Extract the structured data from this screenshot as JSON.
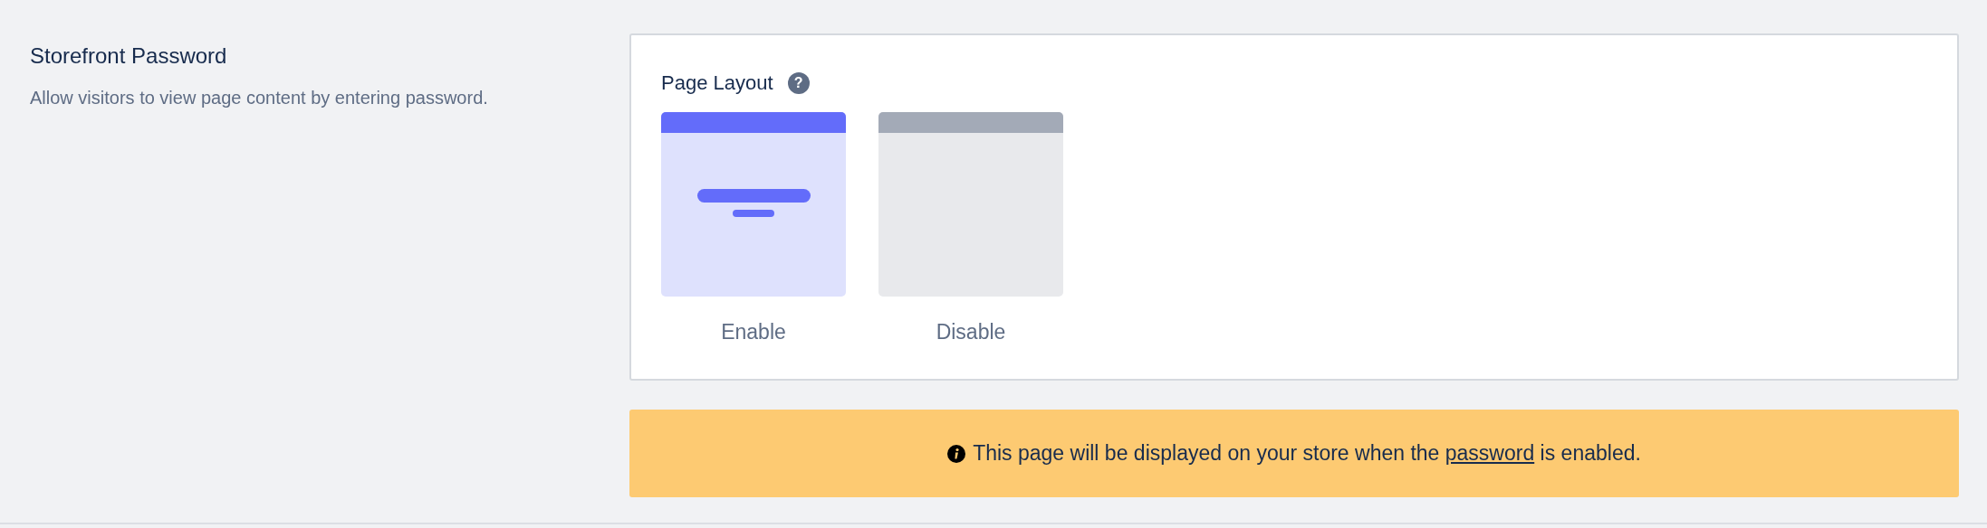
{
  "section": {
    "title": "Storefront Password",
    "description": "Allow visitors to view page content by entering password."
  },
  "page_layout": {
    "label": "Page Layout",
    "help": "?",
    "options": [
      {
        "label": "Enable",
        "selected": true
      },
      {
        "label": "Disable",
        "selected": false
      }
    ]
  },
  "notice": {
    "text_before": "This page will be displayed on your store when the ",
    "link": "password",
    "text_after": " is enabled."
  }
}
